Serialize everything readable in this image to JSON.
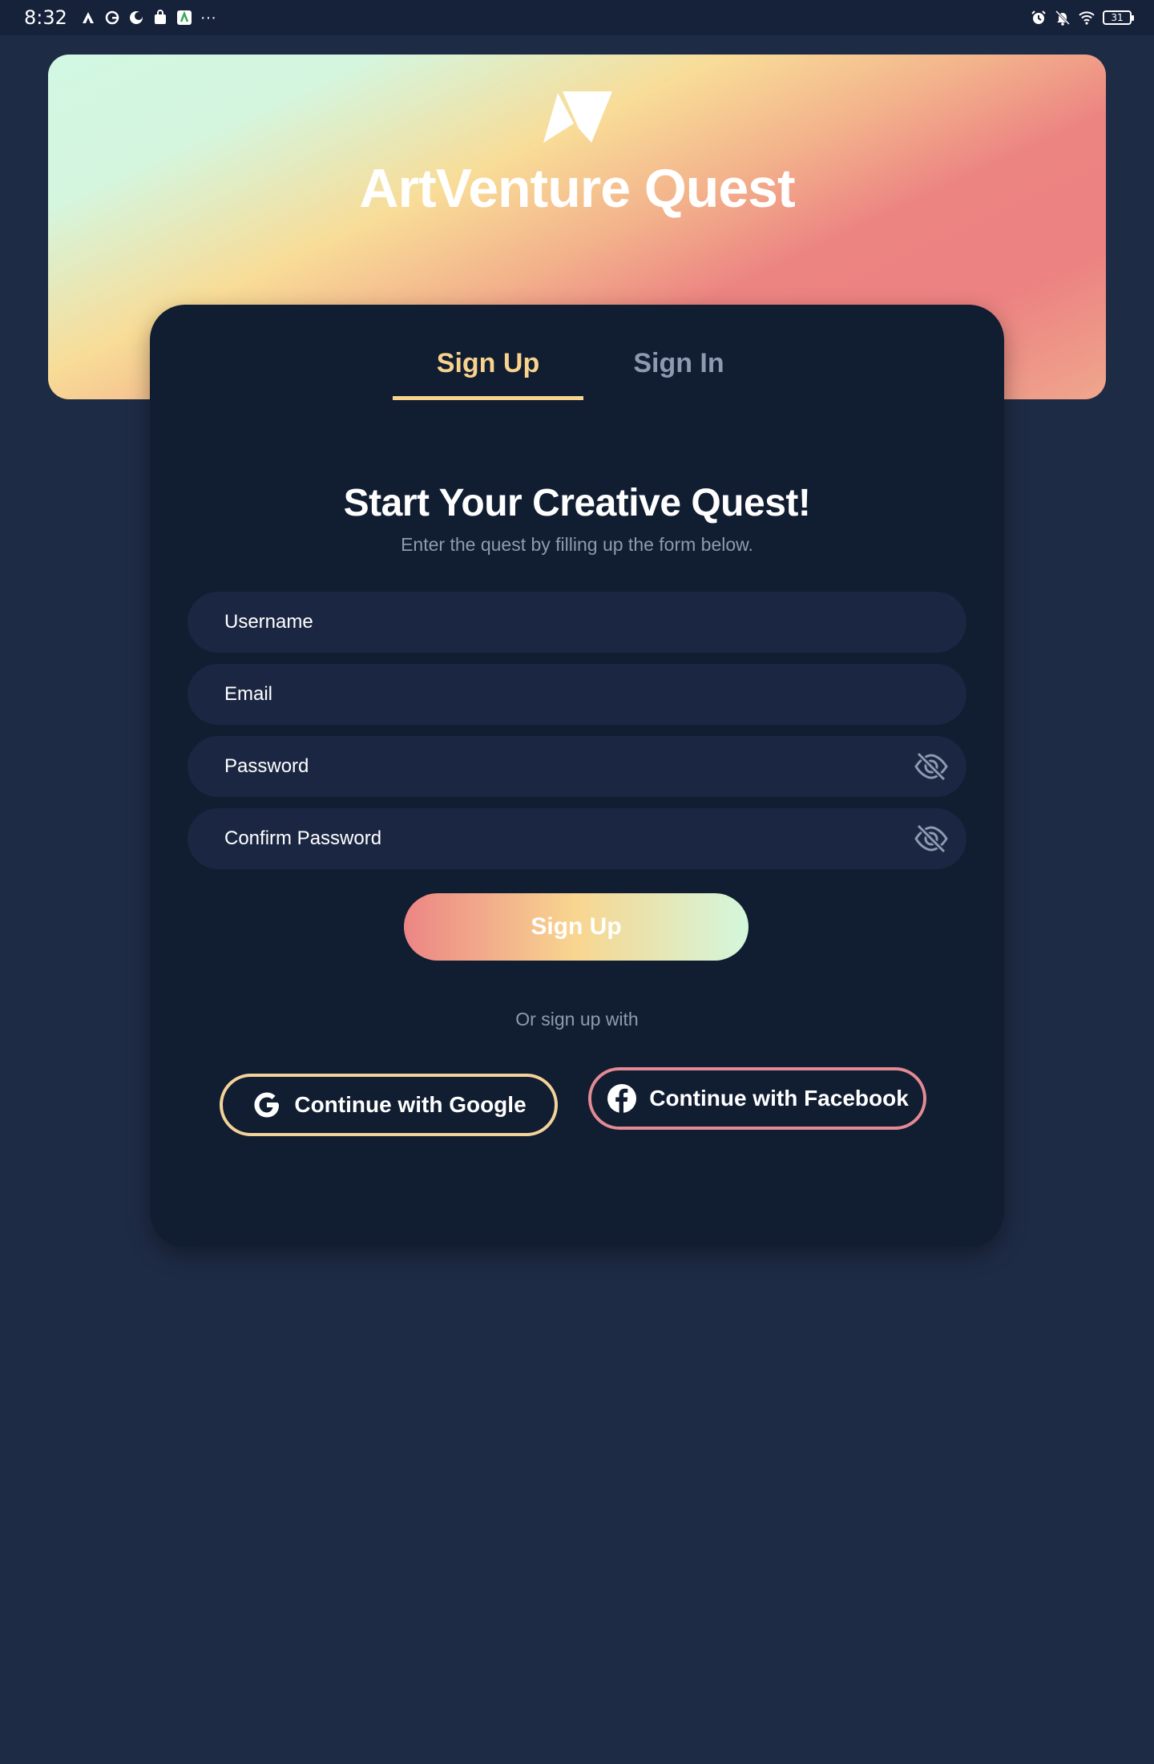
{
  "status_bar": {
    "time": "8:32",
    "left_icons": [
      "a-logo-icon",
      "g-logo-icon",
      "moon-icon",
      "shopping-bag-icon",
      "a-app-icon",
      "more-dots-icon"
    ],
    "more": "···",
    "right_icons": [
      "alarm-icon",
      "bell-muted-icon",
      "wifi-icon",
      "battery-icon"
    ],
    "battery_level": "31"
  },
  "hero": {
    "logo_icon": "paper-plane-logo-icon",
    "title": "ArtVenture Quest",
    "gradient_colors": [
      "#d2f7e2",
      "#f8dc97",
      "#ec8482",
      "#efa78c"
    ]
  },
  "tabs": [
    {
      "label": "Sign Up",
      "active": true
    },
    {
      "label": "Sign In",
      "active": false
    }
  ],
  "form": {
    "heading": "Start Your Creative Quest!",
    "subheading": "Enter the quest by filling up the form below.",
    "fields": {
      "username": {
        "placeholder": "Username",
        "value": ""
      },
      "email": {
        "placeholder": "Email",
        "value": ""
      },
      "password": {
        "placeholder": "Password",
        "value": "",
        "icon": "eye-off-icon"
      },
      "confirm_password": {
        "placeholder": "Confirm Password",
        "value": "",
        "icon": "eye-off-icon"
      }
    },
    "submit_label": "Sign Up",
    "or_text": "Or sign up with",
    "social": {
      "google": {
        "label": "Continue with Google",
        "icon": "google-icon",
        "border_color": "#f4d39a"
      },
      "facebook": {
        "label": "Continue with Facebook",
        "icon": "facebook-icon",
        "border_color": "#e38a95"
      }
    }
  },
  "colors": {
    "background": "#1e2b45",
    "card": "#111d31",
    "field": "#1b2742",
    "accent": "#f7d38d",
    "muted": "#8d9ab0"
  }
}
